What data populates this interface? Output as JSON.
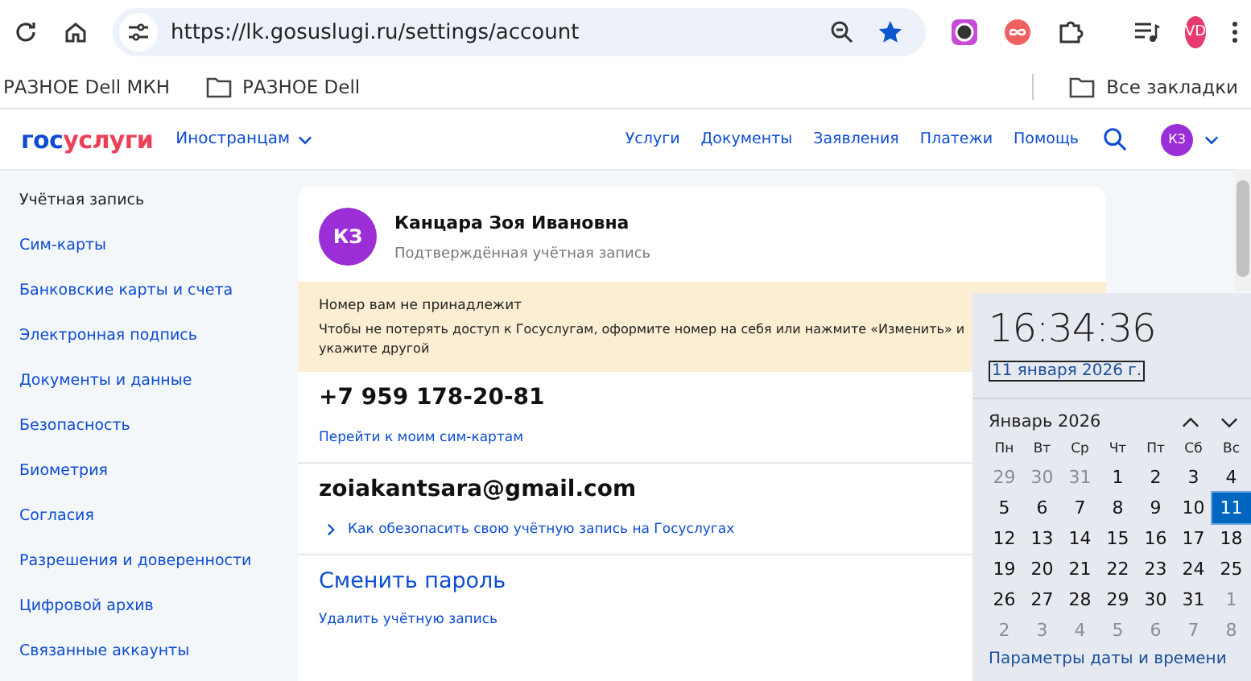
{
  "browser": {
    "url": "https://lk.gosuslugi.ru/settings/account",
    "profile": "VD",
    "bookmarks": [
      {
        "label": "РАЗНОЕ Dell МКН",
        "folder": false
      },
      {
        "label": "РАЗНОЕ Dell",
        "folder": true
      }
    ],
    "all_bookmarks": "Все закладки"
  },
  "site_header": {
    "logo_first": "гос",
    "logo_second": "услуги",
    "region": "Иностранцам",
    "nav": [
      "Услуги",
      "Документы",
      "Заявления",
      "Платежи",
      "Помощь"
    ],
    "avatar": "КЗ"
  },
  "sidebar": {
    "items": [
      {
        "label": "Учётная запись",
        "selected": true
      },
      {
        "label": "Сим-карты",
        "selected": false
      },
      {
        "label": "Банковские карты и счета",
        "selected": false
      },
      {
        "label": "Электронная подпись",
        "selected": false
      },
      {
        "label": "Документы и данные",
        "selected": false
      },
      {
        "label": "Безопасность",
        "selected": false
      },
      {
        "label": "Биометрия",
        "selected": false
      },
      {
        "label": "Согласия",
        "selected": false
      },
      {
        "label": "Разрешения и доверенности",
        "selected": false
      },
      {
        "label": "Цифровой архив",
        "selected": false
      },
      {
        "label": "Связанные аккаунты",
        "selected": false
      }
    ]
  },
  "profile": {
    "avatar": "КЗ",
    "name": "Канцара Зоя Ивановна",
    "status": "Подтверждённая учётная запись"
  },
  "warning": {
    "title": "Номер вам не принадлежит",
    "text": "Чтобы не потерять доступ к Госуслугам, оформите номер на себя или нажмите «Изменить» и укажите другой"
  },
  "phone": {
    "value": "+7 959 178-20-81",
    "link": "Перейти к моим сим-картам"
  },
  "email": {
    "value": "zoiakantsara@gmail.com",
    "link": "Как обезопасить свою учётную запись на Госуслугах"
  },
  "change_password": "Сменить пароль",
  "delete_account": "Удалить учётную запись",
  "clock": {
    "time": "16:34:36",
    "date": "11 января 2026 г.",
    "month": "Январь 2026",
    "weekdays": [
      "Пн",
      "Вт",
      "Ср",
      "Чт",
      "Пт",
      "Сб",
      "Вс"
    ],
    "days": [
      {
        "n": "29",
        "muted": true,
        "selected": false
      },
      {
        "n": "30",
        "muted": true,
        "selected": false
      },
      {
        "n": "31",
        "muted": true,
        "selected": false
      },
      {
        "n": "1",
        "muted": false,
        "selected": false
      },
      {
        "n": "2",
        "muted": false,
        "selected": false
      },
      {
        "n": "3",
        "muted": false,
        "selected": false
      },
      {
        "n": "4",
        "muted": false,
        "selected": false
      },
      {
        "n": "5",
        "muted": false,
        "selected": false
      },
      {
        "n": "6",
        "muted": false,
        "selected": false
      },
      {
        "n": "7",
        "muted": false,
        "selected": false
      },
      {
        "n": "8",
        "muted": false,
        "selected": false
      },
      {
        "n": "9",
        "muted": false,
        "selected": false
      },
      {
        "n": "10",
        "muted": false,
        "selected": false
      },
      {
        "n": "11",
        "muted": false,
        "selected": true
      },
      {
        "n": "12",
        "muted": false,
        "selected": false
      },
      {
        "n": "13",
        "muted": false,
        "selected": false
      },
      {
        "n": "14",
        "muted": false,
        "selected": false
      },
      {
        "n": "15",
        "muted": false,
        "selected": false
      },
      {
        "n": "16",
        "muted": false,
        "selected": false
      },
      {
        "n": "17",
        "muted": false,
        "selected": false
      },
      {
        "n": "18",
        "muted": false,
        "selected": false
      },
      {
        "n": "19",
        "muted": false,
        "selected": false
      },
      {
        "n": "20",
        "muted": false,
        "selected": false
      },
      {
        "n": "21",
        "muted": false,
        "selected": false
      },
      {
        "n": "22",
        "muted": false,
        "selected": false
      },
      {
        "n": "23",
        "muted": false,
        "selected": false
      },
      {
        "n": "24",
        "muted": false,
        "selected": false
      },
      {
        "n": "25",
        "muted": false,
        "selected": false
      },
      {
        "n": "26",
        "muted": false,
        "selected": false
      },
      {
        "n": "27",
        "muted": false,
        "selected": false
      },
      {
        "n": "28",
        "muted": false,
        "selected": false
      },
      {
        "n": "29",
        "muted": false,
        "selected": false
      },
      {
        "n": "30",
        "muted": false,
        "selected": false
      },
      {
        "n": "31",
        "muted": false,
        "selected": false
      },
      {
        "n": "1",
        "muted": true,
        "selected": false
      },
      {
        "n": "2",
        "muted": true,
        "selected": false
      },
      {
        "n": "3",
        "muted": true,
        "selected": false
      },
      {
        "n": "4",
        "muted": true,
        "selected": false
      },
      {
        "n": "5",
        "muted": true,
        "selected": false
      },
      {
        "n": "6",
        "muted": true,
        "selected": false
      },
      {
        "n": "7",
        "muted": true,
        "selected": false
      },
      {
        "n": "8",
        "muted": true,
        "selected": false
      }
    ],
    "settings_link": "Параметры даты и времени"
  }
}
